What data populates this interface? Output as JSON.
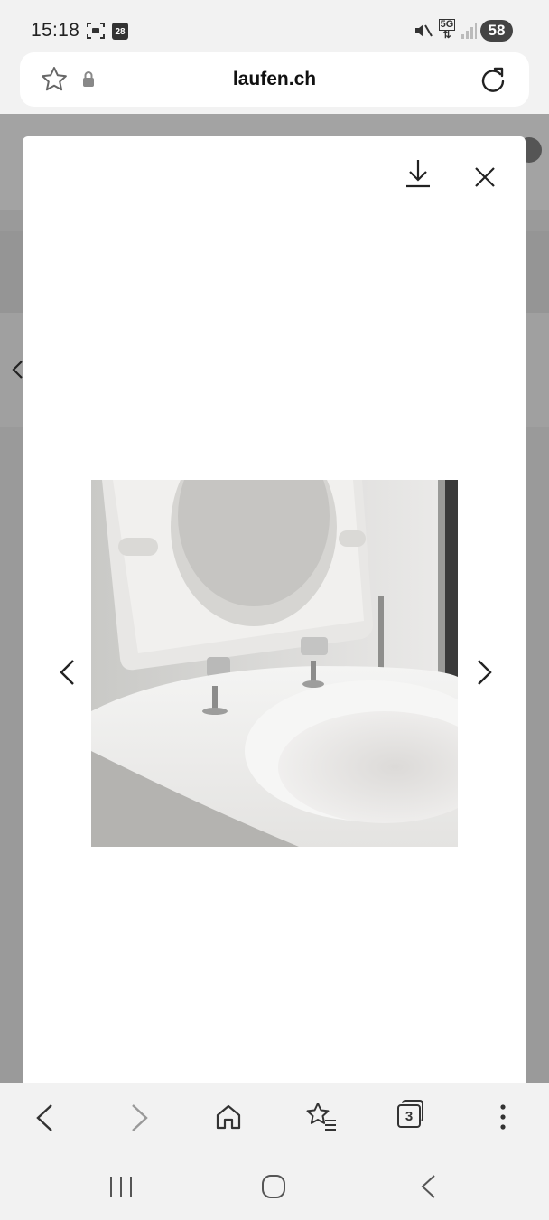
{
  "status_bar": {
    "time": "15:18",
    "calendar_badge": "28",
    "network": "5G",
    "battery": "58"
  },
  "url_bar": {
    "domain": "laufen.ch"
  },
  "modal": {
    "image_icon": "toilet-photo"
  },
  "toolbar": {
    "tab_count": "3"
  }
}
